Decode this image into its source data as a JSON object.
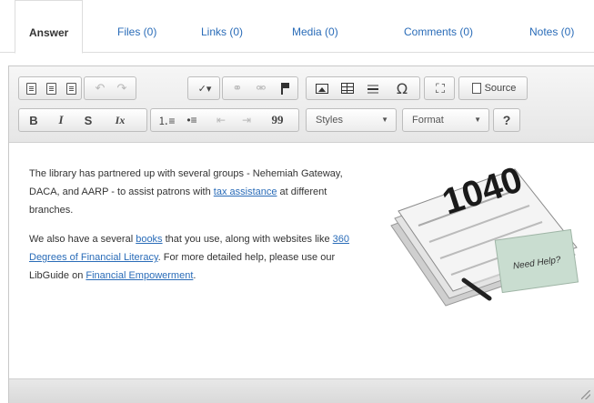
{
  "tabs": {
    "answer": "Answer",
    "files": "Files (0)",
    "links": "Links (0)",
    "media": "Media (0)",
    "comments": "Comments (0)",
    "notes": "Notes (0)"
  },
  "toolbar": {
    "source_label": "Source",
    "bold_label": "B",
    "italic_label": "I",
    "strike_label": "S",
    "remove_format_label": "Ix",
    "blockquote_label": "99",
    "omega_label": "Ω",
    "help_label": "?",
    "styles": {
      "selected": "Styles"
    },
    "format": {
      "selected": "Format"
    }
  },
  "content": {
    "p1_before": "The library has partnered up with several groups - Nehemiah Gateway, DACA, and AARP - to assist patrons with ",
    "p1_link": "tax assistance",
    "p1_after": " at different branches.",
    "p2_a": "We also have a several ",
    "p2_link1": "books",
    "p2_b": " that you use, along with websites like ",
    "p2_link2": "360 Degrees of Financial Literacy",
    "p2_c": ". For more detailed help, please use our LibGuide on ",
    "p2_link3": "Financial Empowerment",
    "p2_d": ".",
    "image": {
      "form_number": "1040",
      "note_text": "Need Help?"
    }
  },
  "colors": {
    "link": "#2a6cb8",
    "toolbar_bg": "#eeeeee",
    "border": "#c8c8c8"
  }
}
